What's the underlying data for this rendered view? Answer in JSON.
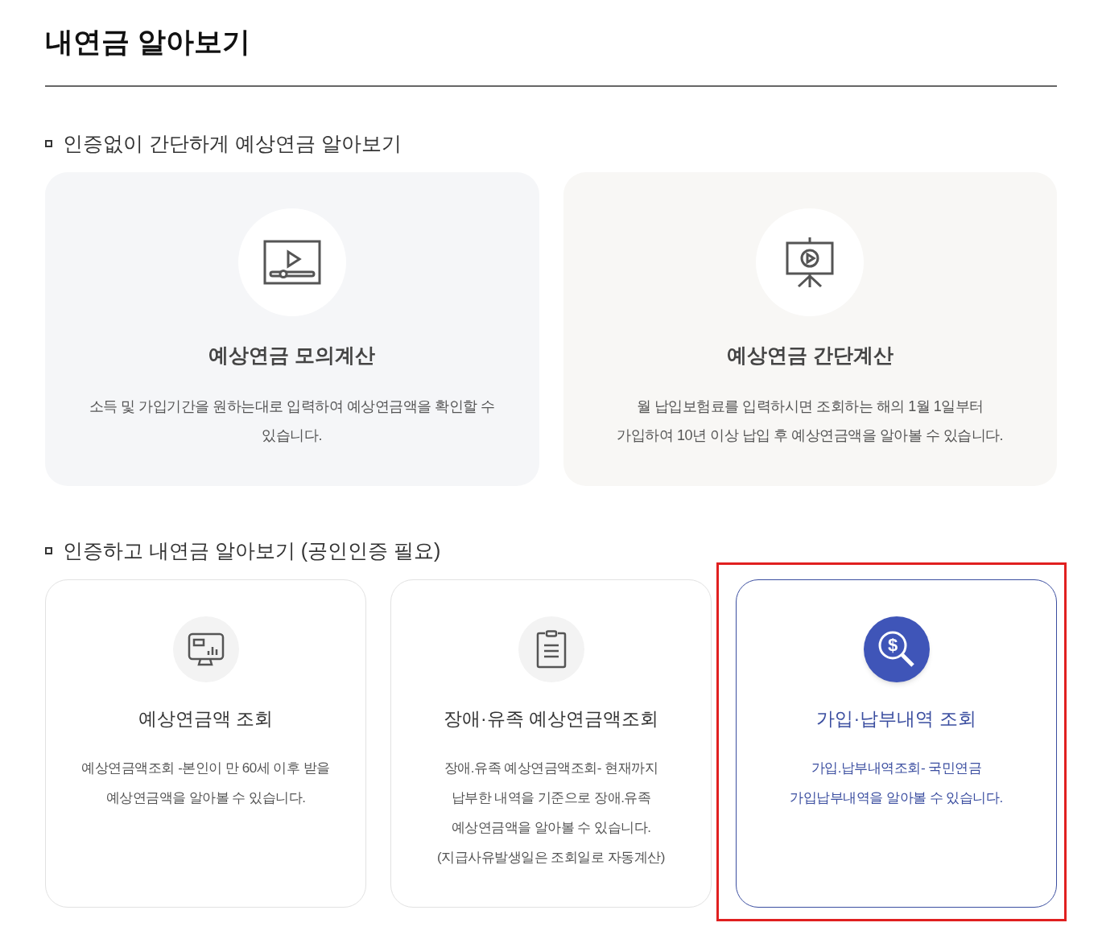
{
  "page_title": "내연금 알아보기",
  "sections": [
    {
      "heading": "인증없이 간단하게 예상연금 알아보기",
      "cards": [
        {
          "kind": "video",
          "title": "예상연금 모의계산",
          "description": "소득 및 가입기간을 원하는대로 입력하여 예상연금액을 확인할 수 있습니다.",
          "selected": false,
          "highlighted": false
        },
        {
          "kind": "presentation",
          "title": "예상연금 간단계산",
          "description": "월 납입보험료를 입력하시면 조회하는 해의 1월 1일부터\n가입하여 10년 이상 납입 후 예상연금액을 알아볼 수 있습니다.",
          "selected": false,
          "highlighted": false
        }
      ]
    },
    {
      "heading": "인증하고 내연금 알아보기 (공인인증 필요)",
      "cards": [
        {
          "kind": "monitor",
          "title": "예상연금액 조회",
          "description": "예상연금액조회 -본인이 만 60세 이후 받을\n예상연금액을 알아볼 수 있습니다.",
          "selected": false,
          "highlighted": false
        },
        {
          "kind": "clipboard",
          "title": "장애·유족 예상연금액조회",
          "description": "장애.유족 예상연금액조회- 현재까지\n납부한 내역을 기준으로 장애.유족\n예상연금액을 알아볼 수 있습니다.\n(지급사유발생일은 조회일로 자동계산)",
          "selected": false,
          "highlighted": false
        },
        {
          "kind": "money-search",
          "icon_symbol": "$",
          "title": "가입·납부내역 조회",
          "description": "가입.납부내역조회- 국민연금\n가입납부내역을 알아볼 수 있습니다.",
          "selected": true,
          "highlighted": true
        }
      ]
    }
  ]
}
